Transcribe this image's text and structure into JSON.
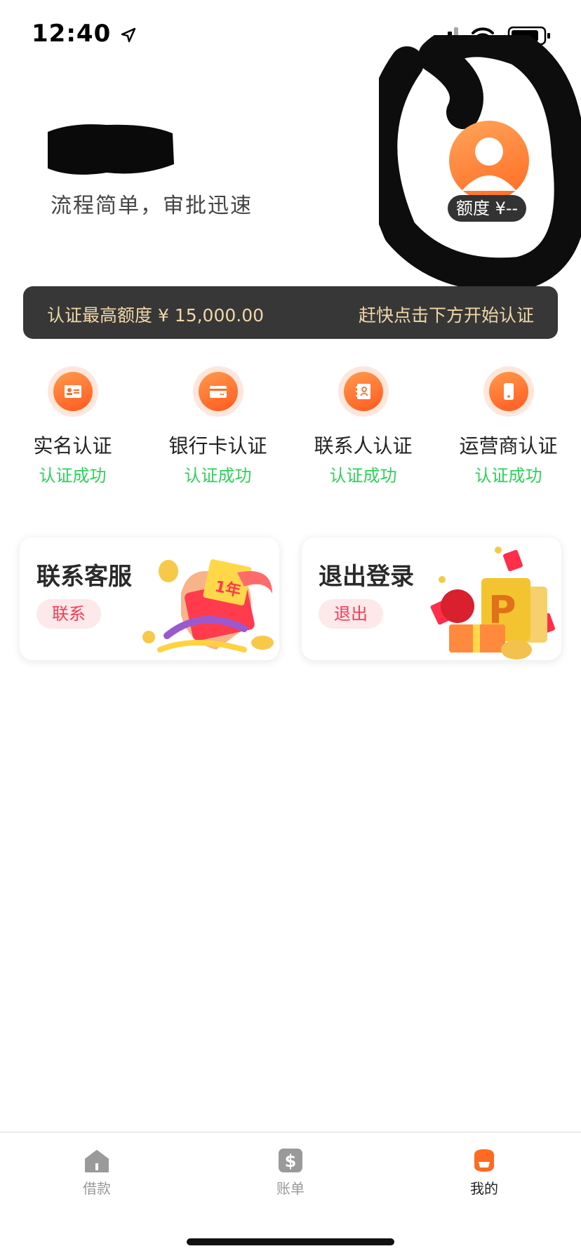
{
  "status_bar": {
    "time": "12:40",
    "icons": [
      "location-arrow-icon",
      "cellular-signal-icon",
      "wifi-icon",
      "battery-icon"
    ]
  },
  "header": {
    "slogan": "流程简单，审批迅速",
    "quota_label": "额度 ¥--",
    "avatar_icon": "avatar-icon"
  },
  "banner": {
    "left_text": "认证最高额度 ¥ 15,000.00",
    "right_text": "赶快点击下方开始认证"
  },
  "verifications": [
    {
      "title": "实名认证",
      "status": "认证成功",
      "icon": "id-card-icon"
    },
    {
      "title": "银行卡认证",
      "status": "认证成功",
      "icon": "bank-card-icon"
    },
    {
      "title": "联系人认证",
      "status": "认证成功",
      "icon": "contacts-icon"
    },
    {
      "title": "运营商认证",
      "status": "认证成功",
      "icon": "phone-icon"
    }
  ],
  "cards": [
    {
      "title": "联系客服",
      "button": "联系"
    },
    {
      "title": "退出登录",
      "button": "退出"
    }
  ],
  "tabbar": {
    "items": [
      {
        "label": "借款",
        "icon": "home-icon",
        "active": false
      },
      {
        "label": "账单",
        "icon": "bill-dollar-icon",
        "active": false
      },
      {
        "label": "我的",
        "icon": "profile-icon",
        "active": true
      }
    ]
  },
  "colors": {
    "accent_orange": "#ff6a22",
    "success_green": "#2dd05a",
    "banner_bg": "#373737",
    "banner_text": "#f1d7a7",
    "card_button_bg": "#fde8ea",
    "card_button_text": "#ee3e58",
    "tab_inactive": "#999999",
    "tab_active": "#222222"
  }
}
